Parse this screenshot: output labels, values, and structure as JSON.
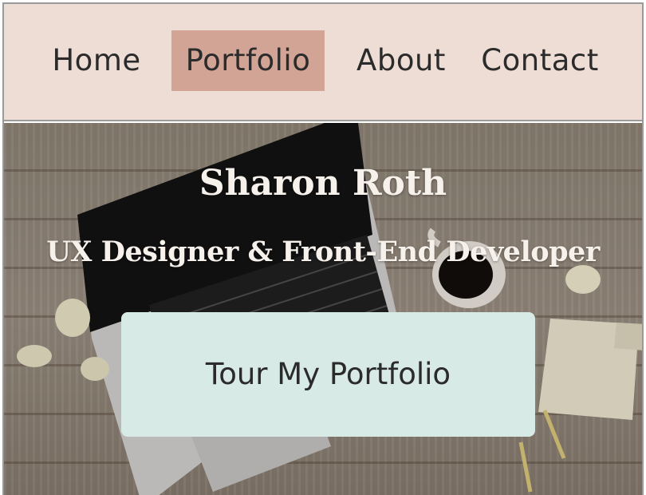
{
  "nav": {
    "items": [
      {
        "label": "Home",
        "active": false
      },
      {
        "label": "Portfolio",
        "active": true
      },
      {
        "label": "About",
        "active": false
      },
      {
        "label": "Contact",
        "active": false
      }
    ]
  },
  "hero": {
    "title": "Sharon Roth",
    "subtitle": "UX Designer & Front-End Developer",
    "cta_label": "Tour My Portfolio"
  },
  "colors": {
    "nav_bg": "#eeddd5",
    "nav_active": "#d1a496",
    "cta_bg": "#d8eae5",
    "text_dark": "#2b2b2b",
    "hero_text": "#f7f1ec"
  }
}
